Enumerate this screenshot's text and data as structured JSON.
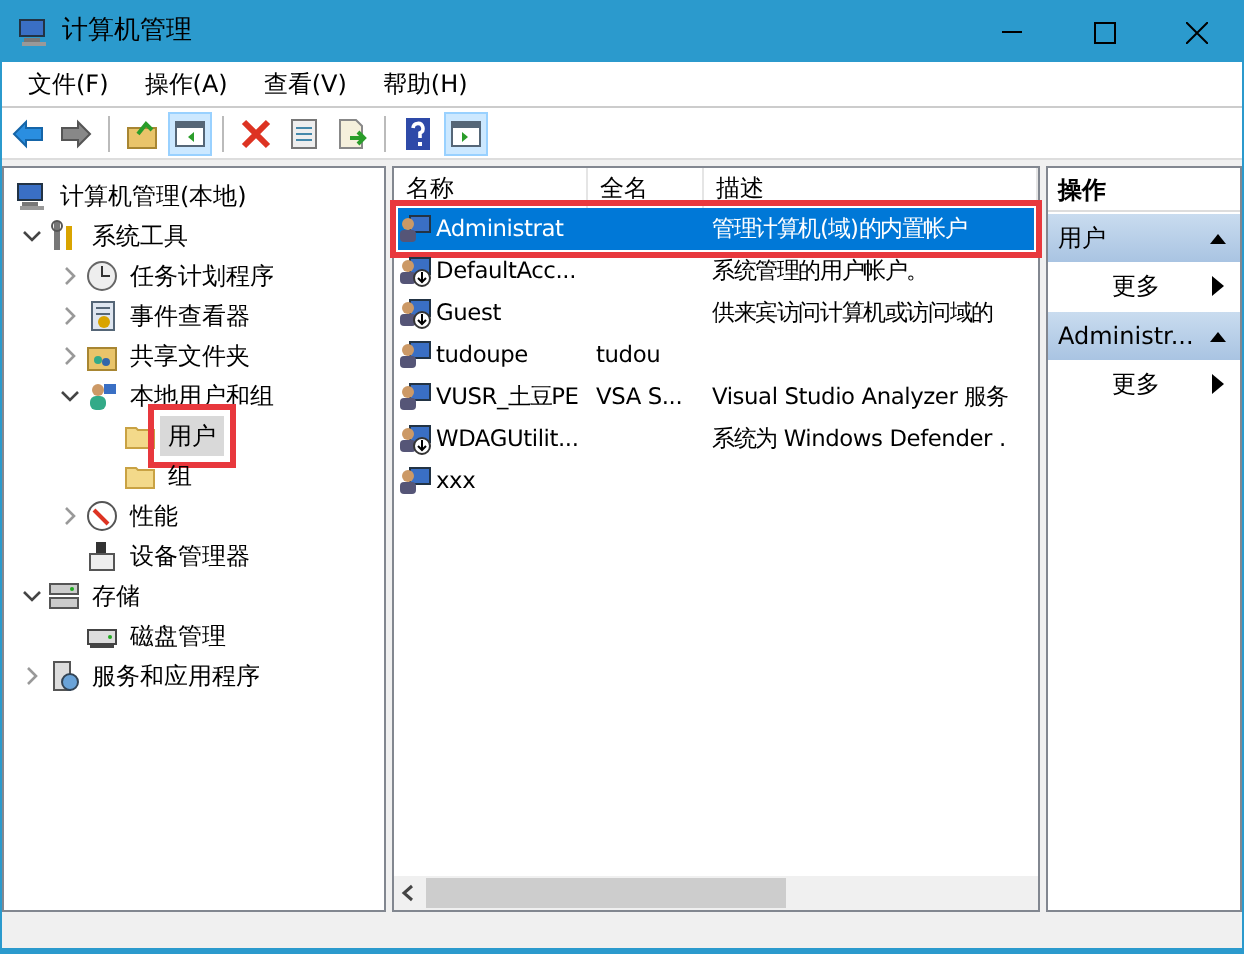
{
  "window": {
    "title": "计算机管理"
  },
  "menu": [
    "文件(F)",
    "操作(A)",
    "查看(V)",
    "帮助(H)"
  ],
  "toolbar": [
    {
      "pressed": false
    },
    {
      "pressed": false
    },
    {
      "pressed": false
    },
    {
      "pressed": true
    },
    {
      "pressed": false
    },
    {
      "pressed": false
    },
    {
      "pressed": false
    },
    {
      "pressed": false
    },
    {
      "pressed": true
    }
  ],
  "tree": [
    {
      "label": "计算机管理(本地)",
      "selected": false,
      "highlighted": false,
      "children": [
        {
          "label": "系统工具",
          "expanded": true,
          "selected": false,
          "highlighted": false,
          "children": [
            {
              "label": "任务计划程序",
              "expanded": false,
              "selected": false,
              "highlighted": false
            },
            {
              "label": "事件查看器",
              "expanded": false,
              "selected": false,
              "highlighted": false
            },
            {
              "label": "共享文件夹",
              "expanded": false,
              "selected": false,
              "highlighted": false
            },
            {
              "label": "本地用户和组",
              "expanded": true,
              "selected": false,
              "highlighted": false,
              "children": [
                {
                  "label": "用户",
                  "selected": true,
                  "highlighted": true
                },
                {
                  "label": "组",
                  "selected": false,
                  "highlighted": false
                }
              ]
            },
            {
              "label": "性能",
              "expanded": false,
              "selected": false,
              "highlighted": false
            },
            {
              "label": "设备管理器",
              "selected": false,
              "highlighted": false
            }
          ]
        },
        {
          "label": "存储",
          "expanded": true,
          "selected": false,
          "highlighted": false,
          "children": [
            {
              "label": "磁盘管理",
              "selected": false,
              "highlighted": false
            }
          ]
        },
        {
          "label": "服务和应用程序",
          "expanded": false,
          "selected": false,
          "highlighted": false
        }
      ]
    }
  ],
  "table": {
    "columns": [
      "名称",
      "全名",
      "描述"
    ],
    "rows": [
      {
        "name": "Administrat",
        "full_name": "",
        "description": "管理计算机(域)的内置帐户",
        "disabled": false,
        "selected": true,
        "highlighted": true
      },
      {
        "name": "DefaultAcc...",
        "full_name": "",
        "description": "系统管理的用户帐户。",
        "disabled": true,
        "selected": false,
        "highlighted": false
      },
      {
        "name": "Guest",
        "full_name": "",
        "description": "供来宾访问计算机或访问域的",
        "disabled": true,
        "selected": false,
        "highlighted": false
      },
      {
        "name": "tudoupe",
        "full_name": "tudou",
        "description": "",
        "disabled": false,
        "selected": false,
        "highlighted": false
      },
      {
        "name": "VUSR_土豆PE",
        "full_name": "VSA S...",
        "description": "Visual Studio Analyzer 服务",
        "disabled": false,
        "selected": false,
        "highlighted": false
      },
      {
        "name": "WDAGUtilit...",
        "full_name": "",
        "description": "系统为 Windows Defender .",
        "disabled": true,
        "selected": false,
        "highlighted": false
      },
      {
        "name": "xxx",
        "full_name": "",
        "description": "",
        "disabled": false,
        "selected": false,
        "highlighted": false
      }
    ]
  },
  "actions": {
    "title": "操作",
    "sections": [
      {
        "title": "用户",
        "items": [
          "更多"
        ]
      },
      {
        "title": "Administr...",
        "items": [
          "更多"
        ]
      }
    ]
  }
}
